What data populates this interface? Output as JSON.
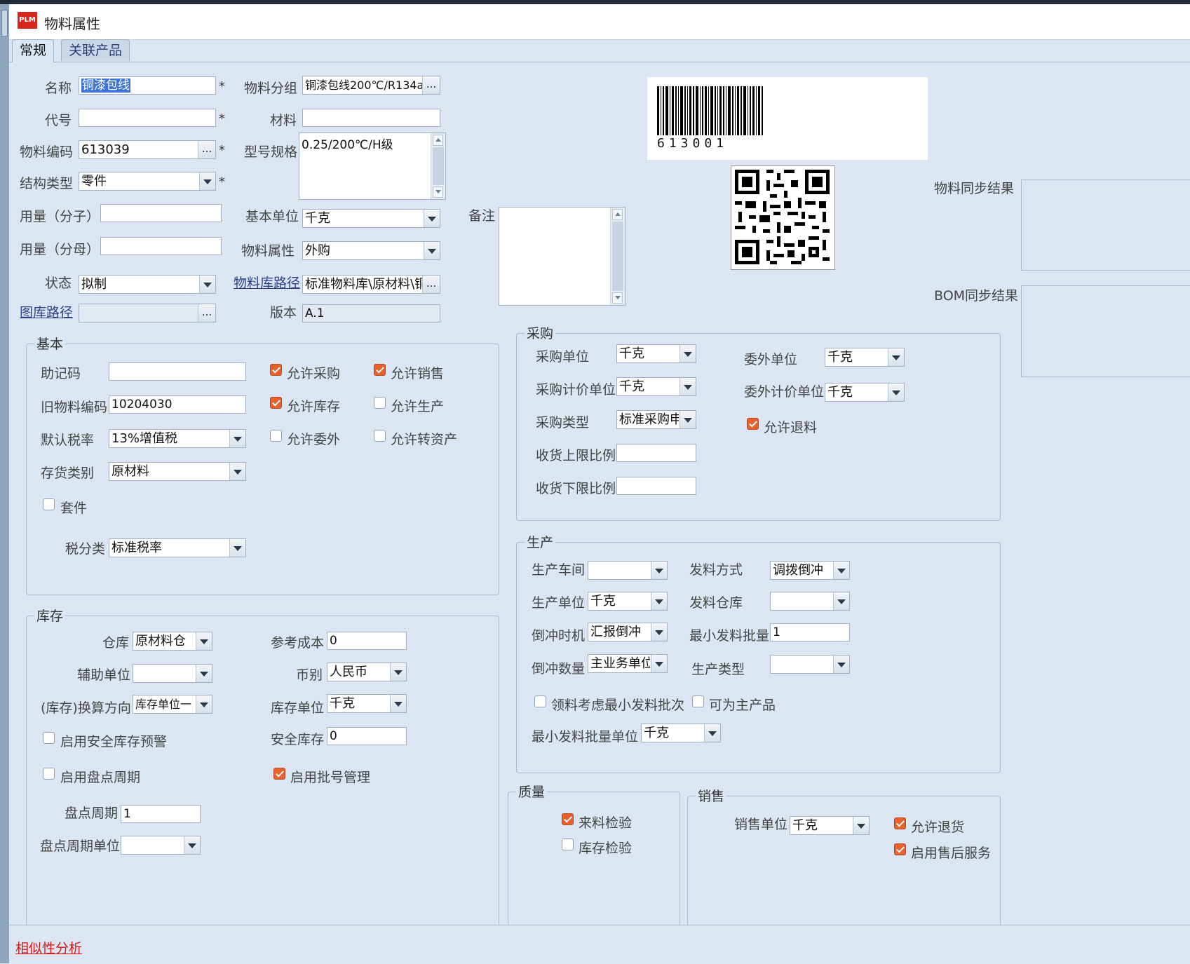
{
  "window": {
    "title": "物料属性",
    "logo_text": "PLM"
  },
  "tabs": [
    {
      "label": "常规"
    },
    {
      "label": "关联产品"
    }
  ],
  "general": {
    "name_label": "名称",
    "name_value": "铜漆包线",
    "code_label": "代号",
    "code_value": "",
    "material_code_label": "物料编码",
    "material_code_value": "613039",
    "struct_type_label": "结构类型",
    "struct_type_value": "零件",
    "qty_num_label": "用量（分子）",
    "qty_num_value": "",
    "qty_den_label": "用量（分母）",
    "qty_den_value": "",
    "status_label": "状态",
    "status_value": "拟制",
    "drawing_path_label": "图库路径",
    "drawing_path_value": "",
    "group_label": "物料分组",
    "group_value": "铜漆包线200℃/R134a",
    "material_label": "材料",
    "material_value": "",
    "spec_label": "型号规格",
    "spec_value": "0.25/200℃/H级",
    "base_unit_label": "基本单位",
    "base_unit_value": "千克",
    "attr_label": "物料属性",
    "attr_value": "外购",
    "lib_path_label": "物料库路径",
    "lib_path_value": "标准物料库\\原材料\\铜",
    "version_label": "版本",
    "version_value": "A.1",
    "remark_label": "备注",
    "remark_value": "",
    "required_mark": "*",
    "ellipsis": "..."
  },
  "barcode": {
    "number": "613001"
  },
  "sync": {
    "material_label": "物料同步结果",
    "bom_label": "BOM同步结果"
  },
  "basic": {
    "title": "基本",
    "mnemonic_label": "助记码",
    "mnemonic_value": "",
    "old_code_label": "旧物料编码",
    "old_code_value": "10204030",
    "tax_rate_label": "默认税率",
    "tax_rate_value": "13%增值税",
    "inv_cat_label": "存货类别",
    "inv_cat_value": "原材料",
    "kit_label": "套件",
    "kit_checked": false,
    "tax_class_label": "税分类",
    "tax_class_value": "标准税率",
    "allow_purchase": {
      "label": "允许采购",
      "checked": true
    },
    "allow_sale": {
      "label": "允许销售",
      "checked": true
    },
    "allow_stock": {
      "label": "允许库存",
      "checked": true
    },
    "allow_produce": {
      "label": "允许生产",
      "checked": false
    },
    "allow_outsource": {
      "label": "允许委外",
      "checked": false
    },
    "allow_asset": {
      "label": "允许转资产",
      "checked": false
    }
  },
  "inventory": {
    "title": "库存",
    "warehouse_label": "仓库",
    "warehouse_value": "原材料仓",
    "aux_unit_label": "辅助单位",
    "aux_unit_value": "",
    "conv_dir_label": "(库存)换算方向",
    "conv_dir_value": "库存单位一",
    "safety_warn": {
      "label": "启用安全库存预警",
      "checked": false
    },
    "count_cycle_enable": {
      "label": "启用盘点周期",
      "checked": false
    },
    "count_cycle_label": "盘点周期",
    "count_cycle_value": "1",
    "count_cycle_unit_label": "盘点周期单位",
    "count_cycle_unit_value": "",
    "ref_cost_label": "参考成本",
    "ref_cost_value": "0",
    "currency_label": "币别",
    "currency_value": "人民币",
    "stock_unit_label": "库存单位",
    "stock_unit_value": "千克",
    "safety_stock_label": "安全库存",
    "safety_stock_value": "0",
    "batch_mgmt": {
      "label": "启用批号管理",
      "checked": true
    }
  },
  "purchase": {
    "title": "采购",
    "unit_label": "采购单位",
    "unit_value": "千克",
    "price_unit_label": "采购计价单位",
    "price_unit_value": "千克",
    "type_label": "采购类型",
    "type_value": "标准采购申",
    "upper_label": "收货上限比例",
    "upper_value": "",
    "lower_label": "收货下限比例",
    "lower_value": "",
    "outsrc_unit_label": "委外单位",
    "outsrc_unit_value": "千克",
    "outsrc_price_label": "委外计价单位",
    "outsrc_price_value": "千克",
    "allow_return": {
      "label": "允许退料",
      "checked": true
    }
  },
  "production": {
    "title": "生产",
    "workshop_label": "生产车间",
    "workshop_value": "",
    "unit_label": "生产单位",
    "unit_value": "千克",
    "backflush_time_label": "倒冲时机",
    "backflush_time_value": "汇报倒冲",
    "backflush_qty_label": "倒冲数量",
    "backflush_qty_value": "主业务单位",
    "issue_method_label": "发料方式",
    "issue_method_value": "调拨倒冲",
    "issue_wh_label": "发料仓库",
    "issue_wh_value": "",
    "min_issue_label": "最小发料批量",
    "min_issue_value": "1",
    "prod_type_label": "生产类型",
    "prod_type_value": "",
    "consider_min": {
      "label": "领料考虑最小发料批次",
      "checked": false
    },
    "main_product": {
      "label": "可为主产品",
      "checked": false
    },
    "min_issue_unit_label": "最小发料批量单位",
    "min_issue_unit_value": "千克"
  },
  "quality": {
    "title": "质量",
    "incoming": {
      "label": "来料检验",
      "checked": true
    },
    "stock_check": {
      "label": "库存检验",
      "checked": false
    }
  },
  "sales": {
    "title": "销售",
    "unit_label": "销售单位",
    "unit_value": "千克",
    "allow_return": {
      "label": "允许退货",
      "checked": true
    },
    "after_sales": {
      "label": "启用售后服务",
      "checked": true
    }
  },
  "footer": {
    "similarity_link": "相似性分析"
  }
}
